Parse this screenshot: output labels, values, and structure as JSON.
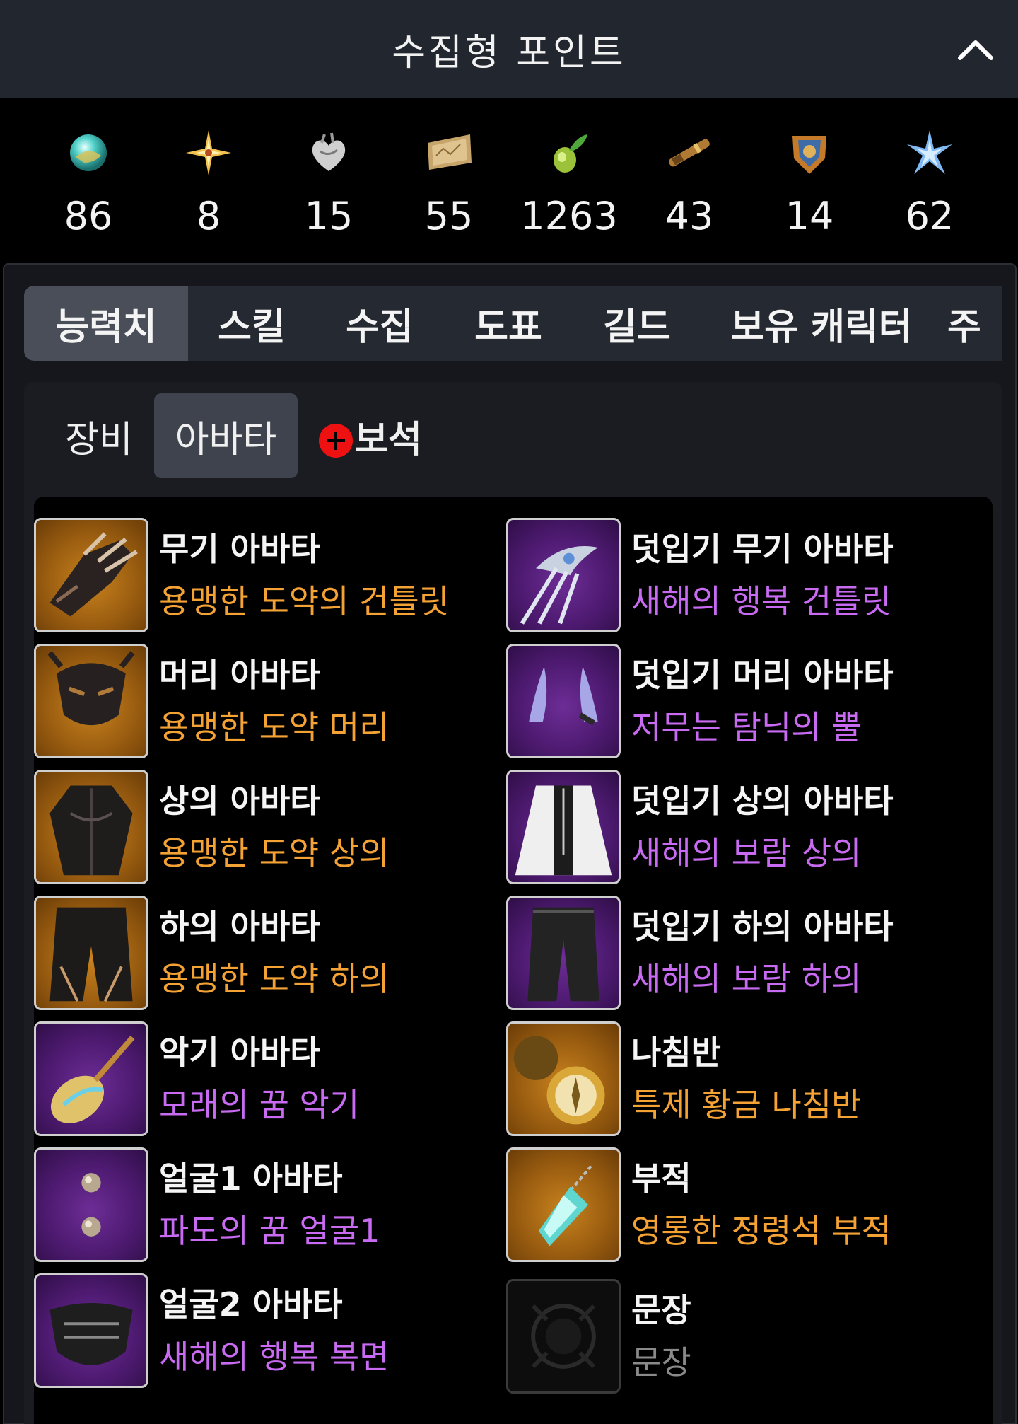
{
  "header": {
    "title": "수집형 포인트",
    "collapse_icon": "chevron-up-icon"
  },
  "points": [
    {
      "icon": "island-orb-icon",
      "value": "86"
    },
    {
      "icon": "giant-heart-star-icon",
      "value": "8"
    },
    {
      "icon": "heart-icon",
      "value": "15"
    },
    {
      "icon": "art-map-icon",
      "value": "55"
    },
    {
      "icon": "mokoko-seed-icon",
      "value": "1263"
    },
    {
      "icon": "voyage-telescope-icon",
      "value": "43"
    },
    {
      "icon": "ignea-token-icon",
      "value": "14"
    },
    {
      "icon": "world-tree-leaf-icon",
      "value": "62"
    }
  ],
  "tabs": [
    {
      "label": "능력치",
      "active": true
    },
    {
      "label": "스킬",
      "active": false
    },
    {
      "label": "수집",
      "active": false
    },
    {
      "label": "도표",
      "active": false
    },
    {
      "label": "길드",
      "active": false
    },
    {
      "label": "보유 캐릭터",
      "active": false
    },
    {
      "label": "주",
      "active": false
    }
  ],
  "subtabs": [
    {
      "label": "장비",
      "active": false
    },
    {
      "label": "아바타",
      "active": true
    },
    {
      "label": "보석",
      "active": false,
      "badge": "plus-icon"
    }
  ],
  "colors": {
    "legendary": "#f5a235",
    "epic": "#c86af2",
    "empty": "#8a8a8a"
  },
  "items": [
    {
      "slot": "무기 아바타",
      "name": "용맹한 도약의 건틀릿",
      "grade": "legendary",
      "icon": "gauntlet-icon"
    },
    {
      "slot": "덧입기 무기 아바타",
      "name": "새해의 행복 건틀릿",
      "grade": "epic",
      "icon": "claw-blade-icon"
    },
    {
      "slot": "머리 아바타",
      "name": "용맹한 도약 머리",
      "grade": "legendary",
      "icon": "mask-icon"
    },
    {
      "slot": "덧입기 머리 아바타",
      "name": "저무는 탐닉의 뿔",
      "grade": "epic",
      "icon": "horns-icon"
    },
    {
      "slot": "상의 아바타",
      "name": "용맹한 도약 상의",
      "grade": "legendary",
      "icon": "armor-top-icon"
    },
    {
      "slot": "덧입기 상의 아바타",
      "name": "새해의 보람 상의",
      "grade": "epic",
      "icon": "white-coat-icon"
    },
    {
      "slot": "하의 아바타",
      "name": "용맹한 도약 하의",
      "grade": "legendary",
      "icon": "armor-pants-icon"
    },
    {
      "slot": "덧입기 하의 아바타",
      "name": "새해의 보람 하의",
      "grade": "epic",
      "icon": "black-pants-icon"
    },
    {
      "slot": "악기 아바타",
      "name": "모래의 꿈 악기",
      "grade": "epic",
      "icon": "lute-icon"
    },
    {
      "slot": "나침반",
      "name": "특제 황금 나침반",
      "grade": "legendary",
      "icon": "compass-icon"
    },
    {
      "slot": "얼굴1 아바타",
      "name": "파도의 꿈 얼굴1",
      "grade": "epic",
      "icon": "earrings-icon"
    },
    {
      "slot": "부적",
      "name": "영롱한 정령석 부적",
      "grade": "legendary",
      "icon": "crystal-charm-icon"
    },
    {
      "slot": "얼굴2 아바타",
      "name": "새해의 행복 복면",
      "grade": "epic",
      "icon": "face-mask-icon"
    },
    {
      "slot": "문장",
      "name": "문장",
      "grade": "empty",
      "icon": "emblem-icon"
    }
  ]
}
